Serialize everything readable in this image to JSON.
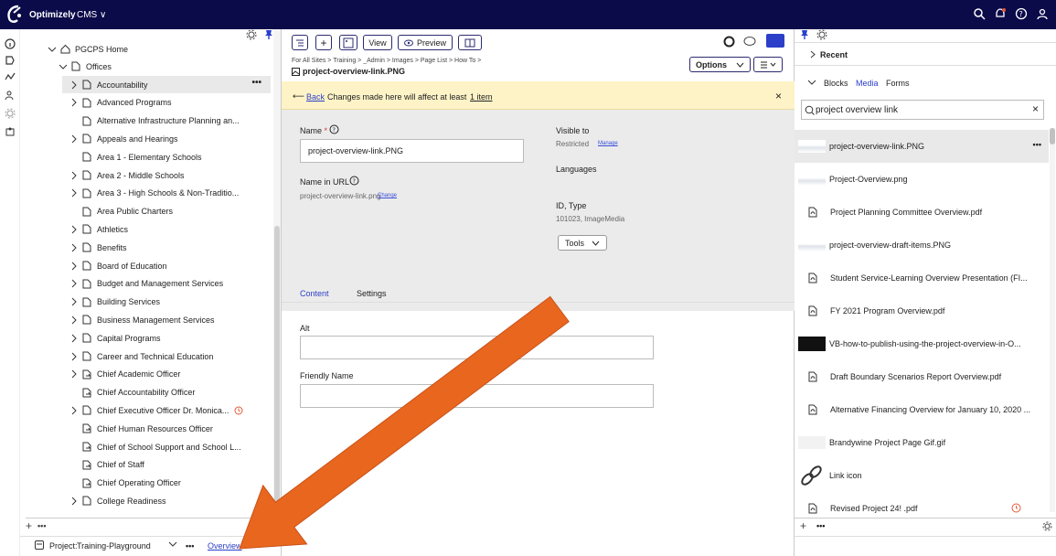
{
  "topbar": {
    "brand": "Optimizely",
    "product": "CMS",
    "product_caret": "∨"
  },
  "tree": {
    "root": "PGCPS Home",
    "offices": "Offices",
    "items": [
      {
        "label": "Accountability",
        "chev": true,
        "icon": "page",
        "selected": true
      },
      {
        "label": "Advanced Programs",
        "chev": true,
        "icon": "page"
      },
      {
        "label": "Alternative Infrastructure Planning an...",
        "chev": false,
        "icon": "page"
      },
      {
        "label": "Appeals and Hearings",
        "chev": true,
        "icon": "page"
      },
      {
        "label": "Area 1 - Elementary Schools",
        "chev": false,
        "icon": "page"
      },
      {
        "label": "Area 2 - Middle Schools",
        "chev": true,
        "icon": "page"
      },
      {
        "label": "Area 3 - High Schools & Non-Traditio...",
        "chev": true,
        "icon": "page"
      },
      {
        "label": "Area Public Charters",
        "chev": false,
        "icon": "page"
      },
      {
        "label": "Athletics",
        "chev": true,
        "icon": "page"
      },
      {
        "label": "Benefits",
        "chev": true,
        "icon": "page"
      },
      {
        "label": "Board of Education",
        "chev": true,
        "icon": "page"
      },
      {
        "label": "Budget and Management Services",
        "chev": true,
        "icon": "page"
      },
      {
        "label": "Building Services",
        "chev": true,
        "icon": "page"
      },
      {
        "label": "Business Management Services",
        "chev": true,
        "icon": "page"
      },
      {
        "label": "Capital Programs",
        "chev": true,
        "icon": "page"
      },
      {
        "label": "Career and Technical Education",
        "chev": true,
        "icon": "page"
      },
      {
        "label": "Chief Academic Officer",
        "chev": true,
        "icon": "shortcut"
      },
      {
        "label": "Chief Accountability Officer",
        "chev": false,
        "icon": "shortcut"
      },
      {
        "label": "Chief Executive Officer Dr. Monica...",
        "chev": true,
        "icon": "page",
        "clock": true
      },
      {
        "label": "Chief Human Resources Officer",
        "chev": false,
        "icon": "shortcut"
      },
      {
        "label": "Chief of School Support and School L...",
        "chev": false,
        "icon": "shortcut"
      },
      {
        "label": "Chief of Staff",
        "chev": false,
        "icon": "shortcut"
      },
      {
        "label": "Chief Operating Officer",
        "chev": false,
        "icon": "shortcut"
      },
      {
        "label": "College Readiness",
        "chev": true,
        "icon": "page"
      }
    ],
    "more_label": "•••"
  },
  "bottombar": {
    "project_label": "Project:",
    "project_value": "Training-Playground",
    "more": "•••",
    "overview": "Overview"
  },
  "toolbar": {
    "view": "View",
    "preview": "Preview",
    "options": "Options"
  },
  "breadcrumb": "For All Sites  >  Training  >  _Admin  >  Images  >  Page List  >  How To  >",
  "item_title": "project-overview-link.PNG",
  "notice": {
    "back": "Back",
    "text": "Changes made here will affect at least",
    "count": "1 item"
  },
  "props": {
    "name_label": "Name",
    "required": "*",
    "name_value": "project-overview-link.PNG",
    "name_in_url_label": "Name in URL",
    "name_in_url_value": "project-overview-link.png",
    "change": "Change",
    "visible_to_label": "Visible to",
    "visible_to_value": "Restricted",
    "manage": "Manage",
    "languages_label": "Languages",
    "id_type_label": "ID, Type",
    "id_type_value": "101023, ImageMedia",
    "tools": "Tools"
  },
  "tabs": {
    "content": "Content",
    "settings": "Settings"
  },
  "fields": {
    "alt_label": "Alt",
    "alt_value": "",
    "friendly_label": "Friendly Name",
    "friendly_value": ""
  },
  "right": {
    "recent": "Recent",
    "tabs": [
      "Blocks",
      "Media",
      "Forms"
    ],
    "active_tab": "Media",
    "search_value": "project overview link",
    "clear": "×",
    "media": [
      {
        "name": "project-overview-link.PNG",
        "kind": "image",
        "selected": true
      },
      {
        "name": "Project-Overview.png",
        "kind": "image"
      },
      {
        "name": "Project Planning Committee Overview.pdf",
        "kind": "pdf"
      },
      {
        "name": "project-overview-draft-items.PNG",
        "kind": "image"
      },
      {
        "name": "Student Service-Learning Overview Presentation (FI...",
        "kind": "pdf"
      },
      {
        "name": "FY 2021 Program Overview.pdf",
        "kind": "pdf"
      },
      {
        "name": "VB-how-to-publish-using-the-project-overview-in-O...",
        "kind": "video"
      },
      {
        "name": "Draft Boundary Scenarios Report Overview.pdf",
        "kind": "pdf"
      },
      {
        "name": "Alternative Financing Overview for January 10, 2020 ...",
        "kind": "pdf"
      },
      {
        "name": "Brandywine Project Page Gif.gif",
        "kind": "gif"
      },
      {
        "name": "Link icon",
        "kind": "link"
      },
      {
        "name": "Revised Project 24! .pdf",
        "kind": "pdf",
        "clock": true
      }
    ],
    "more": "•••"
  },
  "colors": {
    "topbar": "#0b0b4a",
    "accent": "#3a4fd9",
    "arrow": "#e8661e",
    "notice": "#fef3c7",
    "clock": "#e05a3a"
  }
}
